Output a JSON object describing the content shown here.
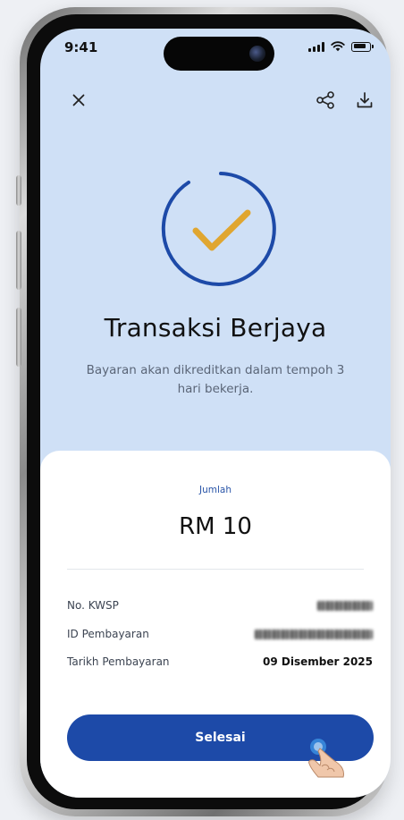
{
  "status_bar": {
    "time": "9:41"
  },
  "header": {
    "close_icon": "close-icon",
    "share_icon": "share-icon",
    "download_icon": "download-icon"
  },
  "result": {
    "title": "Transaksi Berjaya",
    "subtitle": "Bayaran akan dikreditkan dalam tempoh 3 hari bekerja."
  },
  "summary": {
    "amount_label": "Jumlah",
    "amount_value": "RM 10",
    "rows": [
      {
        "label": "No. KWSP",
        "value": "",
        "redacted": true
      },
      {
        "label": "ID Pembayaran",
        "value": "",
        "redacted": true
      },
      {
        "label": "Tarikh Pembayaran",
        "value": "09 Disember 2025",
        "redacted": false
      }
    ]
  },
  "actions": {
    "done_label": "Selesai"
  },
  "colors": {
    "top_background": "#cfe0f6",
    "primary_button": "#1d4aa8",
    "check_ring": "#1d4aa8",
    "check_mark": "#e0a630",
    "amount_label": "#2a55a8"
  }
}
